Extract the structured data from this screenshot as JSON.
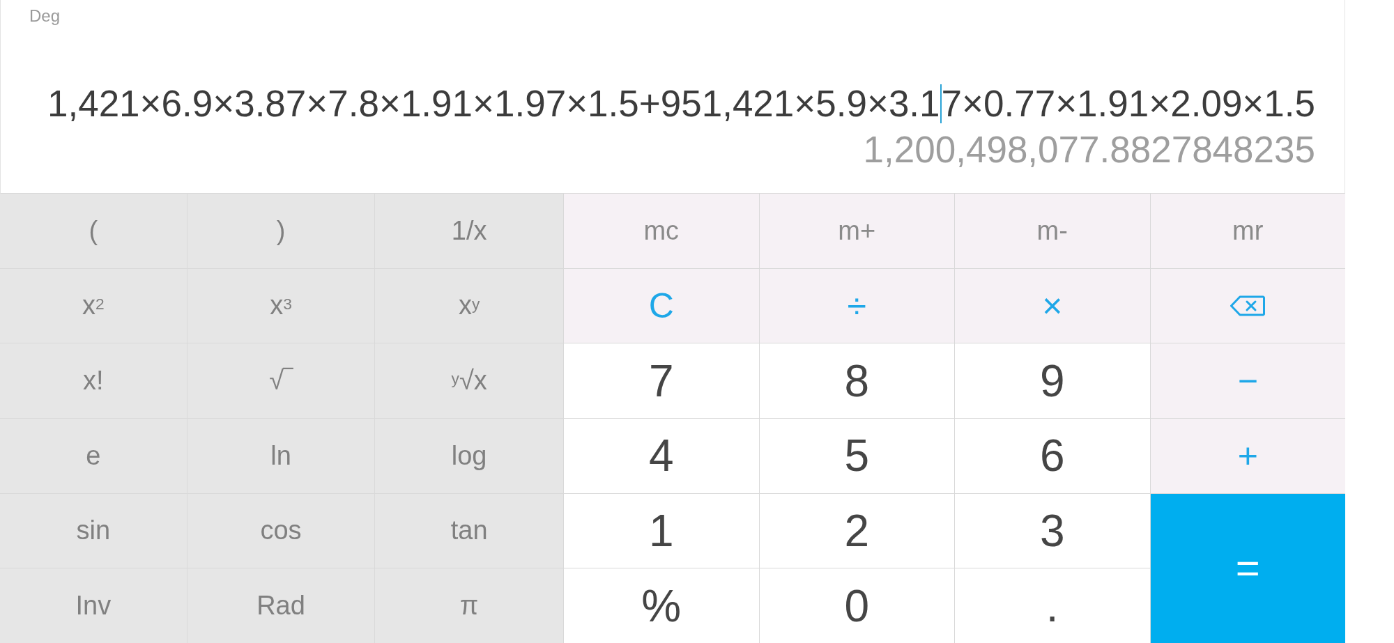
{
  "display": {
    "angle_mode": "Deg",
    "expression": {
      "before_cursor": "1,421×6.9×3.87×7.8×1.91×1.97×1.5+951,421×5.9×3.1",
      "after_cursor": "7×0.77×1.91×2.09×1.5"
    },
    "result": "1,200,498,077.8827848235"
  },
  "function_keys": [
    [
      "(",
      ")",
      "1/x"
    ],
    [
      "x$^{2}$",
      "x$^{3}$",
      "x$^{y}$"
    ],
    [
      "x!",
      "√‾",
      "$^{y}$√x"
    ],
    [
      "e",
      "ln",
      "log"
    ],
    [
      "sin",
      "cos",
      "tan"
    ],
    [
      "Inv",
      "Rad",
      "π"
    ]
  ],
  "keypad": [
    [
      {
        "kind": "memory",
        "label": "mc"
      },
      {
        "kind": "memory",
        "label": "m+"
      },
      {
        "kind": "memory",
        "label": "m-"
      },
      {
        "kind": "memory",
        "label": "mr"
      }
    ],
    [
      {
        "kind": "operator",
        "label": "C"
      },
      {
        "kind": "operator",
        "label": "÷"
      },
      {
        "kind": "operator",
        "label": "×"
      },
      {
        "kind": "backspace"
      }
    ],
    [
      {
        "kind": "number",
        "label": "7"
      },
      {
        "kind": "number",
        "label": "8"
      },
      {
        "kind": "number",
        "label": "9"
      },
      {
        "kind": "operator",
        "label": "−"
      }
    ],
    [
      {
        "kind": "number",
        "label": "4"
      },
      {
        "kind": "number",
        "label": "5"
      },
      {
        "kind": "number",
        "label": "6"
      },
      {
        "kind": "operator",
        "label": "+"
      }
    ],
    [
      {
        "kind": "number",
        "label": "1"
      },
      {
        "kind": "number",
        "label": "2"
      },
      {
        "kind": "number",
        "label": "3"
      },
      {
        "kind": "equals",
        "label": "="
      }
    ],
    [
      {
        "kind": "number",
        "label": "%"
      },
      {
        "kind": "number",
        "label": "0"
      },
      {
        "kind": "number",
        "label": "."
      }
    ]
  ]
}
